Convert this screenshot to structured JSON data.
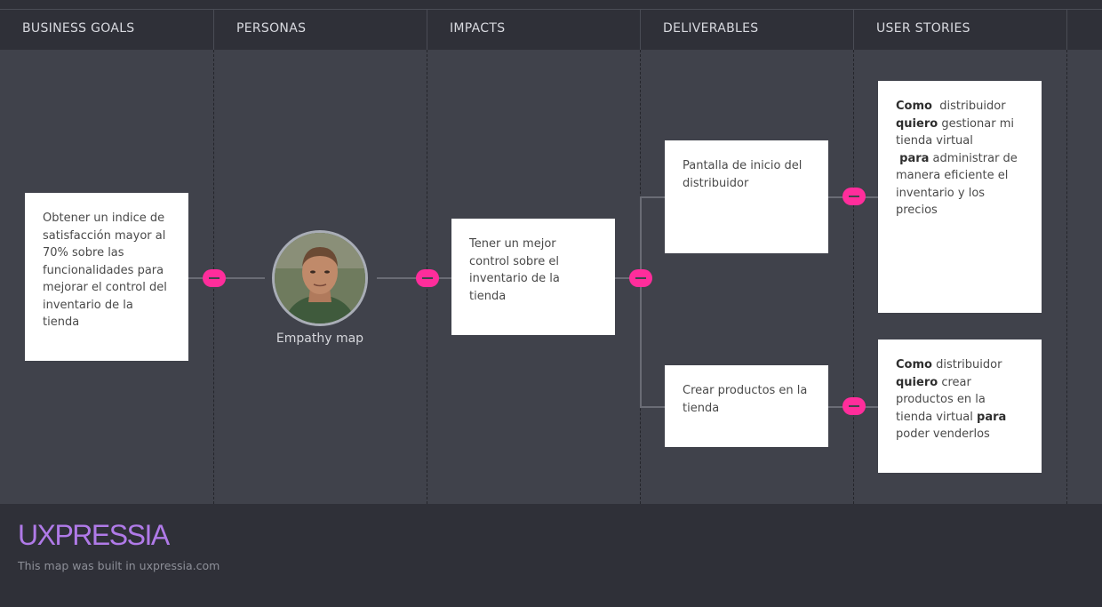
{
  "columns": [
    {
      "label": "BUSINESS GOALS"
    },
    {
      "label": "PERSONAS"
    },
    {
      "label": "IMPACTS"
    },
    {
      "label": "DELIVERABLES"
    },
    {
      "label": "USER STORIES"
    }
  ],
  "goal": {
    "text": "Obtener un indice de satisfacción mayor al 70% sobre las funcionalidades para mejorar el control del inventario de la tienda"
  },
  "persona": {
    "label": "Empathy map",
    "avatar_icon": "person-photo"
  },
  "impact": {
    "text": "Tener un mejor control sobre el inventario de la tienda"
  },
  "deliverables": [
    {
      "text": "Pantalla de inicio del distribuidor"
    },
    {
      "text": "Crear productos en la tienda"
    }
  ],
  "stories": [
    {
      "como": "Como",
      "role": "distribuidor",
      "quiero": "quiero",
      "want": "gestionar mi tienda virtual",
      "para": "para",
      "benefit": "administrar de manera eficiente el inventario y los precios"
    },
    {
      "como": "Como",
      "role": "distribuidor",
      "quiero": "quiero",
      "want": "crear productos en la tienda virtual",
      "para": "para",
      "benefit": "poder venderlos"
    }
  ],
  "footer": {
    "logo": "UXPRESSIA",
    "credit": "This map was built in uxpressia.com"
  },
  "colors": {
    "accent": "#ff2d9b",
    "logo": "#b07ae8",
    "board": "#40424b",
    "header": "#2f3038"
  }
}
